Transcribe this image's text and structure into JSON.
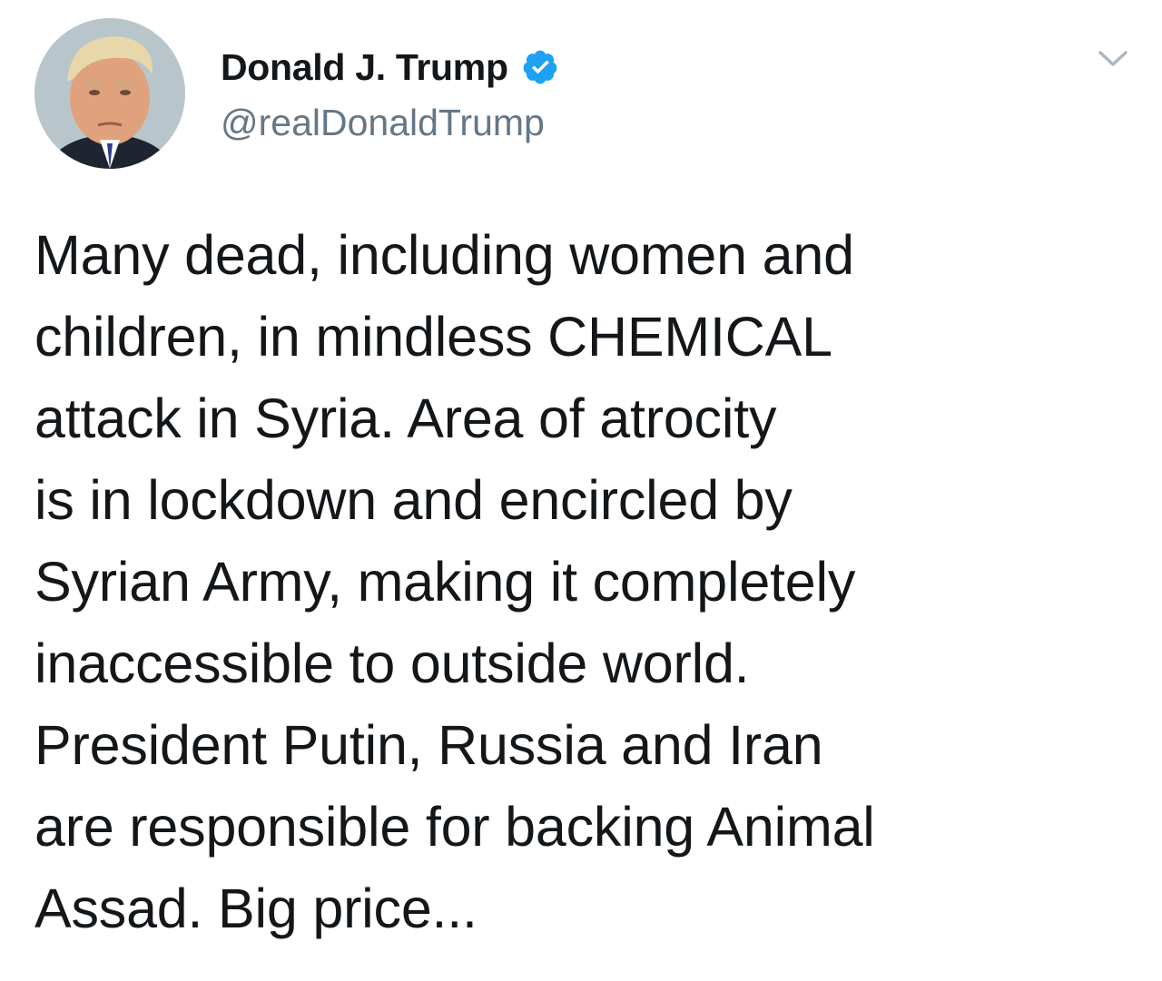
{
  "author": {
    "display_name": "Donald J. Trump",
    "handle": "@realDonaldTrump",
    "verified": true,
    "avatar": "profile-photo"
  },
  "icons": {
    "verified": "verified-badge-icon",
    "menu": "chevron-down-icon"
  },
  "colors": {
    "verified_blue": "#1da1f2",
    "handle_gray": "#657786",
    "text": "#14171a",
    "caret_gray": "#aab8c2"
  },
  "tweet": {
    "lines": [
      "Many dead, including women and",
      "children, in mindless CHEMICAL",
      "attack in Syria. Area of atrocity",
      "is in lockdown and encircled by",
      "Syrian Army, making it completely",
      "inaccessible to outside world.",
      "President Putin, Russia and Iran",
      "are responsible for backing Animal",
      "Assad. Big price..."
    ]
  }
}
